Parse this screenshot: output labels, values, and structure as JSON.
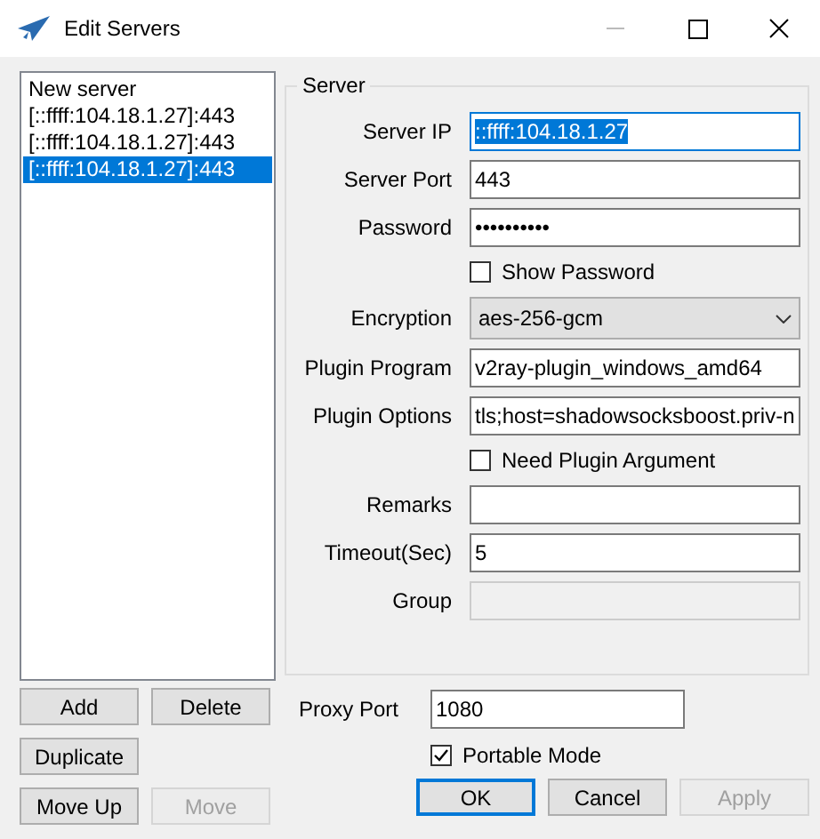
{
  "window": {
    "title": "Edit Servers"
  },
  "servers": [
    {
      "label": "New server",
      "selected": false
    },
    {
      "label": "[::ffff:104.18.1.27]:443",
      "selected": false
    },
    {
      "label": "[::ffff:104.18.1.27]:443",
      "selected": false
    },
    {
      "label": "[::ffff:104.18.1.27]:443",
      "selected": true
    }
  ],
  "server_group": {
    "title": "Server",
    "fields": [
      {
        "kind": "text",
        "label": "Server IP",
        "value": "::ffff:104.18.1.27",
        "focused": true,
        "text_selected": true
      },
      {
        "kind": "text",
        "label": "Server Port",
        "value": "443"
      },
      {
        "kind": "password",
        "label": "Password",
        "value": "••••••••••"
      },
      {
        "kind": "checkbox",
        "label": "Show Password",
        "checked": false
      },
      {
        "kind": "select",
        "label": "Encryption",
        "value": "aes-256-gcm"
      },
      {
        "kind": "text",
        "label": "Plugin Program",
        "value": "v2ray-plugin_windows_amd64"
      },
      {
        "kind": "text",
        "label": "Plugin Options",
        "value": "tls;host=shadowsocksboost.priv-n"
      },
      {
        "kind": "checkbox",
        "label": "Need Plugin Argument",
        "checked": false
      },
      {
        "kind": "text",
        "label": "Remarks"
      },
      {
        "kind": "text",
        "label": "Timeout(Sec)",
        "value": "5"
      },
      {
        "kind": "text",
        "label": "Group",
        "disabled": true
      }
    ]
  },
  "list_buttons": [
    [
      {
        "label": "Add",
        "disabled": false
      },
      {
        "label": "Delete",
        "disabled": false
      }
    ],
    [
      {
        "label": "Duplicate",
        "disabled": false
      }
    ],
    [
      {
        "label": "Move Up",
        "disabled": false
      },
      {
        "label": "Move",
        "disabled": true
      }
    ]
  ],
  "proxy_port": {
    "label": "Proxy Port",
    "value": "1080"
  },
  "portable_mode": {
    "label": "Portable Mode",
    "checked": true
  },
  "dialog_buttons": [
    {
      "label": "OK",
      "disabled": false,
      "default": true
    },
    {
      "label": "Cancel",
      "disabled": false,
      "default": false
    },
    {
      "label": "Apply",
      "disabled": true,
      "default": false
    }
  ]
}
